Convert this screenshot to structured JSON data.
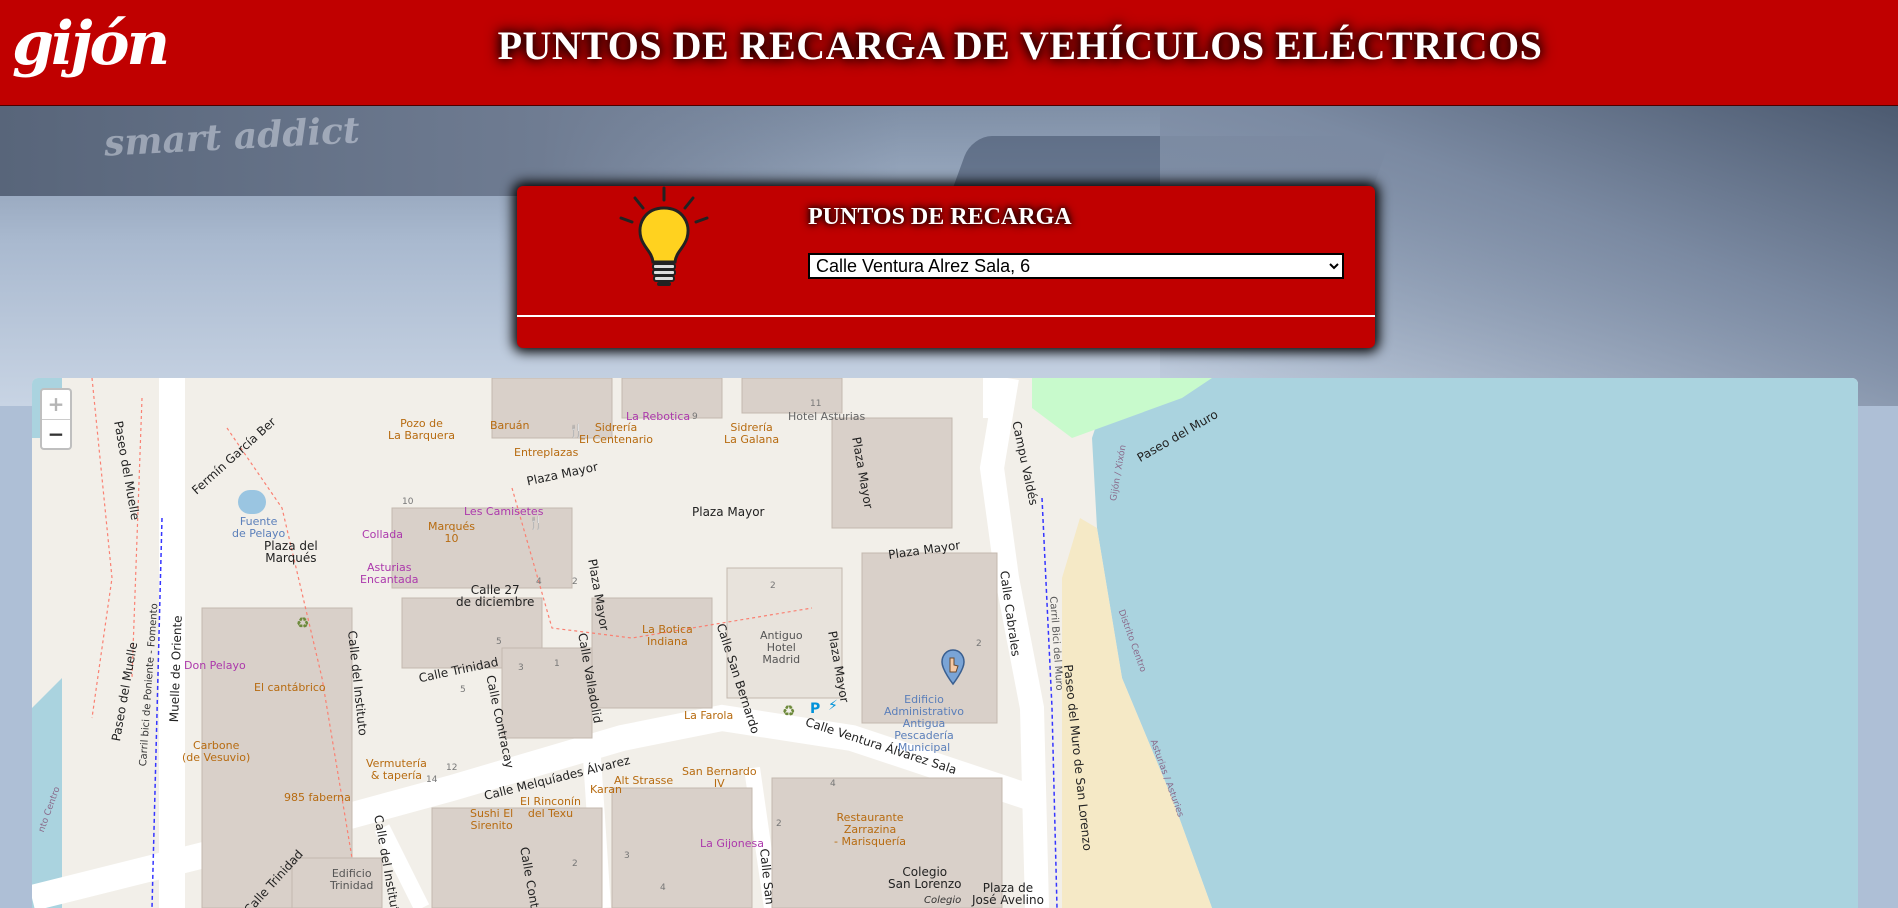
{
  "header": {
    "logo_text": "gijón",
    "title": "PUNTOS DE RECARGA DE VEHÍCULOS ELÉCTRICOS",
    "background_color": "#c00000"
  },
  "hero": {
    "watermark_text": "smart addict"
  },
  "panel": {
    "icon": "lightbulb-icon",
    "title": "PUNTOS DE RECARGA",
    "select_value": "Calle Ventura Alrez Sala, 6"
  },
  "map": {
    "zoom_in_label": "+",
    "zoom_out_label": "−",
    "marker_icon": "hand-pointer-icon",
    "labels": {
      "fermin": "Fermín García Ber",
      "paseo_muelle": "Paseo del Muelle",
      "paseo_muelle2": "Paseo del Muelle",
      "pozo": "Pozo de\nLa Barquera",
      "baruan": "Baruán",
      "entreplazas": "Entreplazas",
      "sidreria_centenario": "Sidrería\nEl Centenario",
      "rebotica": "La Rebotica",
      "galana": "Sidrería\nLa Galana",
      "hotel_asturias": "Hotel Asturias",
      "plaza_mayor_street1": "Plaza Mayor",
      "plaza_mayor_street2": "Plaza Mayor",
      "plaza_mayor_area": "Plaza Mayor",
      "plaza_mayor_vert1": "Plaza Mayor",
      "plaza_mayor_vert2": "Plaza Mayor",
      "plaza_mayor_vert3": "Plaza Mayor",
      "fuente": "Fuente\nde Pelayo",
      "plaza_marques": "Plaza del\nMarqués",
      "collada": "Collada",
      "marques10": "Marqués\n10",
      "camisetes": "Les Camisetes",
      "asturias_encantada": "Asturias\nEncantada",
      "calle27": "Calle 27\nde diciembre",
      "calle_trinidad": "Calle Trinidad",
      "calle_instituto": "Calle del Instituto",
      "calle_valladolid": "Calle Valladolid",
      "botica": "La Botica\nIndiana",
      "san_bernardo": "Calle San Bernardo",
      "antiguo_hotel": "Antiguo\nHotel\nMadrid",
      "edificio_admin": "Edificio\nAdministrativo\nAntigua\nPescadería\nMunicipal",
      "calle_cabrales": "Calle Cabrales",
      "campu_valdes": "Campu Valdés",
      "paseo_muro": "Paseo del Muro",
      "paseo_muro_sl": "Paseo del Muro de San Lorenzo",
      "carril_muro": "Carril Bici del Muro",
      "gijon_xixon": "Gijón / Xixón",
      "distrito_centro": "Distrito Centro",
      "asturias": "Asturias / Asturies",
      "carril_poniente": "Carril bici de Poniente - Fomento",
      "muelle_oriente": "Muelle de Oriente",
      "don_pelayo": "Don Pelayo",
      "cantabrico": "El cantábrico",
      "carbone": "Carbone\n(de Vesuvio)",
      "faberna": "985 faberna",
      "vermuteria": "Vermutería\n& tapería",
      "contracay": "Calle Contracay",
      "farola": "La Farola",
      "melquiades": "Calle Melquíades Álvarez",
      "ventura": "Calle Ventura Álvarez Sala",
      "san_bernardo_iv": "San Bernardo\nIV",
      "alt_strasse": "Alt Strasse",
      "karan": "Karan",
      "rinconin": "El Rinconín\ndel Texu",
      "sushi": "Sushi El\nSirenito",
      "gijonesa": "La Gijonesa",
      "restaurante": "Restaurante\nZarrazina\n- Marisquería",
      "colegio": "Colegio\nSan Lorenzo",
      "colegio2": "Colegio",
      "plaza_jose": "Plaza de\nJosé Avelino",
      "edificio_trinidad": "Edificio\nTrinidad",
      "calle_trinidad2": "Calle Trinidad",
      "calle_instituto2": "Calle del Instituto",
      "calle_contr2": "Calle Contr",
      "calle_sanb2": "Calle San B",
      "nto_centro": "nto Centro",
      "num_10": "10",
      "num_11": "11",
      "num_9": "9",
      "num_2a": "2",
      "num_2b": "2",
      "num_2c": "2",
      "num_4": "4",
      "num_5": "5",
      "num_3": "3",
      "num_1": "1",
      "num_12": "12",
      "num_14": "14",
      "num_4b": "4",
      "num_2d": "2",
      "num_4c": "4",
      "num_2e": "2",
      "num_3b": "3",
      "num_5b": "5"
    }
  }
}
